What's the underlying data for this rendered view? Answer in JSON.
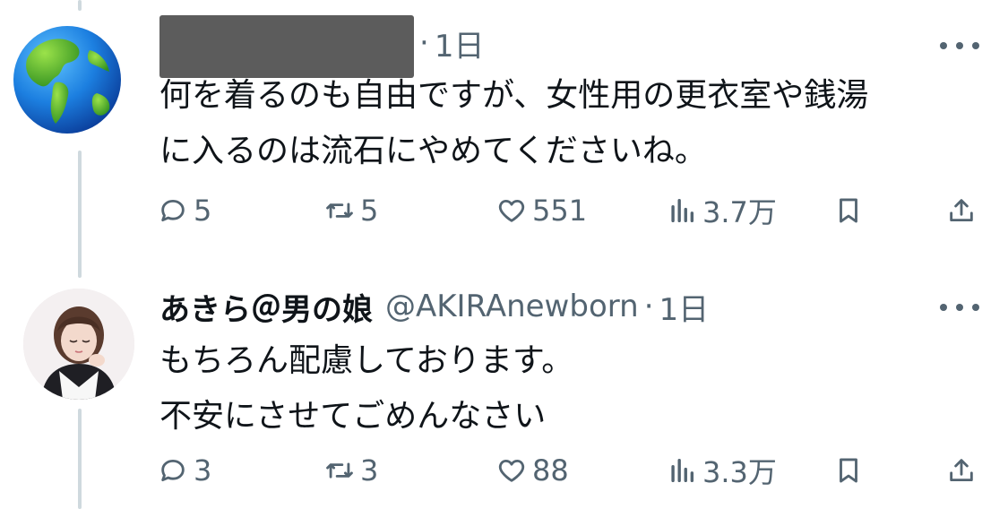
{
  "tweets": [
    {
      "author_name": "",
      "handle": "",
      "separator": "·",
      "time": "1日",
      "lines": [
        "何を着るのも自由ですが、女性用の更衣室や銭湯",
        "に入るのは流石にやめてくださいね。"
      ],
      "stats": {
        "replies": "5",
        "retweets": "5",
        "likes": "551",
        "views": "3.7万"
      }
    },
    {
      "author_name": "あきら＠男の娘",
      "handle": "@AKIRAnewborn",
      "separator": "·",
      "time": "1日",
      "lines": [
        "もちろん配慮しております。",
        "不安にさせてごめんなさい"
      ],
      "stats": {
        "replies": "3",
        "retweets": "3",
        "likes": "88",
        "views": "3.3万"
      }
    }
  ],
  "icons": {
    "reply": "reply-icon",
    "retweet": "retweet-icon",
    "like": "heart-icon",
    "views": "views-chart-icon",
    "bookmark": "bookmark-icon",
    "share": "share-icon",
    "more": "more-icon"
  },
  "colors": {
    "text": "#0f1419",
    "secondary": "#536471",
    "thread_line": "#cfd9de"
  }
}
